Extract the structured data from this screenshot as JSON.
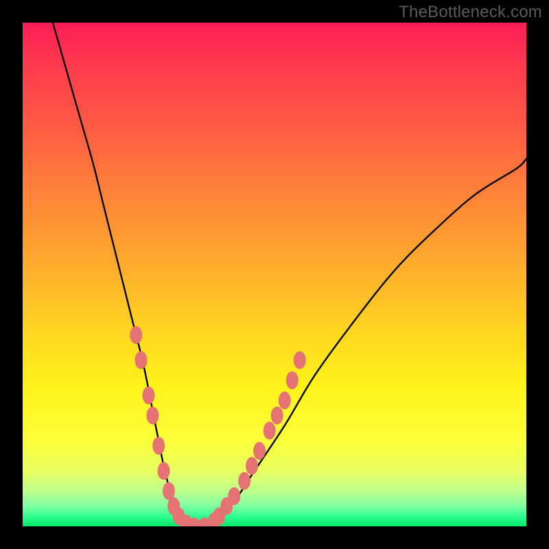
{
  "watermark": "TheBottleneck.com",
  "colors": {
    "frame": "#000000",
    "gradient_top": "#ff1d58",
    "gradient_mid": "#fff21a",
    "gradient_bottom": "#00e869",
    "curve_stroke": "#000000",
    "marker_fill": "#e57373",
    "marker_stroke": "#b94a4a"
  },
  "chart_data": {
    "type": "line",
    "title": "",
    "xlabel": "",
    "ylabel": "",
    "xlim": [
      0,
      100
    ],
    "ylim": [
      0,
      100
    ],
    "series": [
      {
        "name": "bottleneck-curve",
        "x": [
          6,
          8,
          10,
          12,
          14,
          16,
          18,
          20,
          22,
          24,
          26,
          27,
          28,
          29,
          30,
          31,
          32,
          34,
          36,
          38,
          42,
          46,
          52,
          58,
          66,
          74,
          82,
          90,
          98,
          100
        ],
        "y": [
          100,
          93,
          86,
          79,
          72,
          64,
          56,
          48,
          40,
          32,
          22,
          17,
          12,
          8,
          5,
          2,
          1,
          0,
          0,
          1,
          5,
          11,
          20,
          30,
          41,
          51,
          59,
          66,
          71,
          73
        ]
      }
    ],
    "markers": [
      {
        "x": 22.5,
        "y": 38
      },
      {
        "x": 23.5,
        "y": 33
      },
      {
        "x": 25.0,
        "y": 26
      },
      {
        "x": 25.8,
        "y": 22
      },
      {
        "x": 27.0,
        "y": 16
      },
      {
        "x": 28.0,
        "y": 11
      },
      {
        "x": 29.0,
        "y": 7
      },
      {
        "x": 30.0,
        "y": 4
      },
      {
        "x": 31.0,
        "y": 2
      },
      {
        "x": 32.5,
        "y": 0.5
      },
      {
        "x": 34.0,
        "y": 0
      },
      {
        "x": 36.0,
        "y": 0
      },
      {
        "x": 38.0,
        "y": 1
      },
      {
        "x": 39.0,
        "y": 2
      },
      {
        "x": 40.5,
        "y": 4
      },
      {
        "x": 42.0,
        "y": 6
      },
      {
        "x": 44.0,
        "y": 9
      },
      {
        "x": 45.5,
        "y": 12
      },
      {
        "x": 47.0,
        "y": 15
      },
      {
        "x": 49.0,
        "y": 19
      },
      {
        "x": 50.5,
        "y": 22
      },
      {
        "x": 52.0,
        "y": 25
      },
      {
        "x": 53.5,
        "y": 29
      },
      {
        "x": 55.0,
        "y": 33
      }
    ]
  }
}
